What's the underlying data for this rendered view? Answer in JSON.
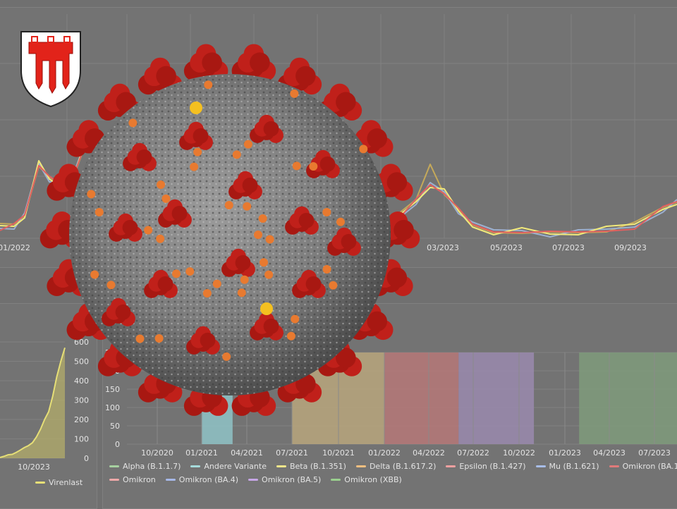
{
  "chart_data": [
    {
      "type": "line",
      "xlabel": "",
      "ylabel": "",
      "tick_labels": [
        "01/2022",
        "03/2023",
        "05/2023",
        "07/2023",
        "09/2023"
      ],
      "series_colors": [
        "#c5a95a",
        "#9cb0d0",
        "#f2ea7a",
        "#e06060"
      ],
      "grid": true
    },
    {
      "type": "area",
      "series": [
        {
          "name": "Virenlast",
          "color": "#e6df77",
          "values": [
            4,
            10,
            18,
            20,
            30,
            42,
            55,
            65,
            80,
            110,
            150,
            200,
            240,
            320,
            420,
            500,
            570
          ]
        }
      ],
      "x_ticks": [
        "2023",
        "10/2023"
      ],
      "y_ticks": [
        "600",
        "500",
        "400",
        "300",
        "200",
        "100",
        "0"
      ],
      "ylim": [
        0,
        600
      ]
    },
    {
      "type": "area",
      "stacked_percent": true,
      "x_ticks": [
        "10/2020",
        "01/2021",
        "04/2021",
        "07/2021",
        "10/2021",
        "01/2022",
        "04/2022",
        "07/2022",
        "10/2022",
        "01/2023",
        "04/2023",
        "07/2023"
      ],
      "y_ticks": [
        "250",
        "200",
        "150",
        "100",
        "50",
        "0"
      ],
      "legend": [
        {
          "name": "Alpha (B.1.1.7)",
          "color": "#a6d0a0"
        },
        {
          "name": "Andere Variante",
          "color": "#a6dcdc"
        },
        {
          "name": "Beta (B.1.351)",
          "color": "#efe58a"
        },
        {
          "name": "Delta (B.1.617.2)",
          "color": "#f2bf80"
        },
        {
          "name": "Epsilon (B.1.427)",
          "color": "#f0a0a0"
        },
        {
          "name": "Mu (B.1.621)",
          "color": "#a8bde8"
        },
        {
          "name": "Omikron (BA.1)",
          "color": "#e07a7a"
        },
        {
          "name": "Omikron",
          "color": "#eea8a8"
        },
        {
          "name": "Omikron (BA.4)",
          "color": "#a6b8e8"
        },
        {
          "name": "Omikron (BA.5)",
          "color": "#c6a6e6"
        },
        {
          "name": "Omikron (XBB)",
          "color": "#9ad08e"
        }
      ],
      "bands": [
        {
          "name": "Andere Variante",
          "start": "01/2021",
          "end": "03/2021",
          "color": "#8fc3c7"
        },
        {
          "name": "Delta (B.1.617.2)",
          "start": "07/2021",
          "end": "01/2022",
          "color": "#b9a67c"
        },
        {
          "name": "Omikron (BA.1)",
          "start": "01/2022",
          "end": "06/2022",
          "color": "#b67878"
        },
        {
          "name": "Omikron (BA.5)",
          "start": "06/2022",
          "end": "11/2022",
          "color": "#9a8aae"
        },
        {
          "name": "Omikron (XBB)",
          "start": "02/2023",
          "end": "09/2023",
          "color": "#7f9b7b"
        }
      ]
    }
  ],
  "crest": {
    "colors": {
      "field": "#e2231a",
      "outline": "#222222",
      "background": "#ffffff"
    }
  },
  "virus": {
    "colors": {
      "body": "#8a8a8a",
      "spike": "#c0201a",
      "protein": "#e87a30",
      "highlight": "#f4c020"
    }
  }
}
